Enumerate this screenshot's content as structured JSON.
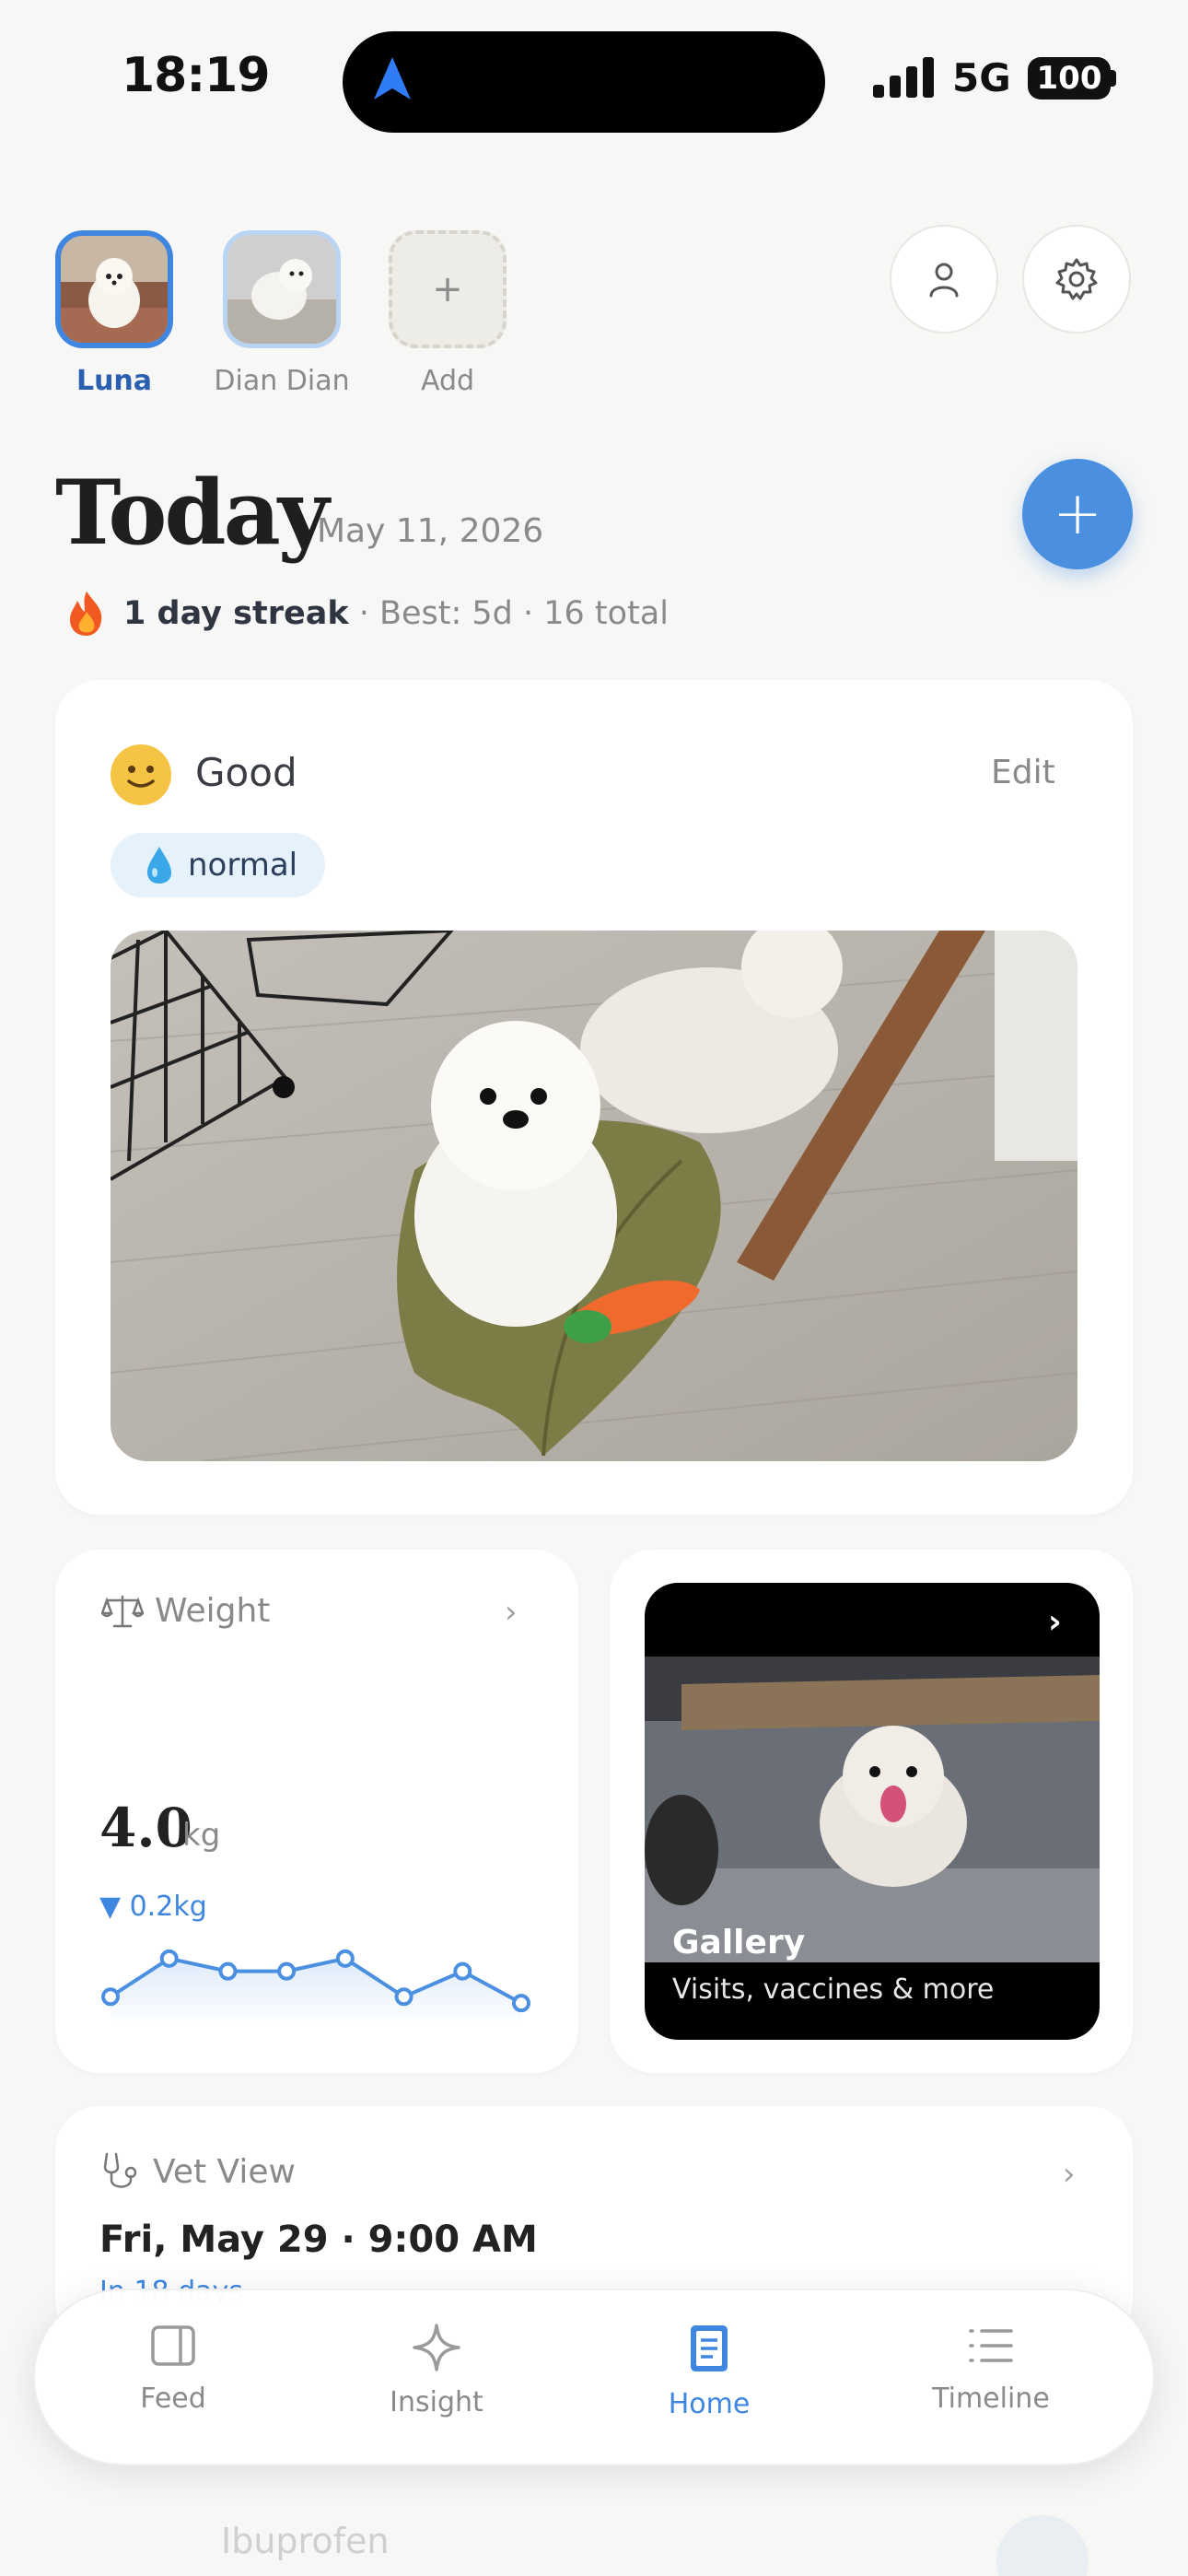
{
  "status_bar": {
    "time": "18:19",
    "network": "5G",
    "battery": "100"
  },
  "pets": [
    {
      "name": "Luna",
      "selected": true
    },
    {
      "name": "Dian Dian",
      "selected": false
    },
    {
      "name": "Add",
      "add_button": true,
      "icon": "plus-icon"
    }
  ],
  "header_actions": {
    "profile_icon": "person-icon",
    "settings_icon": "gear-icon"
  },
  "header": {
    "title": "Today",
    "date": "May 11, 2026",
    "add_icon": "plus-icon"
  },
  "streak": {
    "icon": "fire-icon",
    "label": "1 day streak",
    "details": "· Best: 5d · 16 total"
  },
  "mood": {
    "emoji": "slightly-smiling-face",
    "label": "Good",
    "edit_label": "Edit",
    "chip_icon": "droplet-icon",
    "chip_label": "normal"
  },
  "weight": {
    "title": "Weight",
    "value": "4.0",
    "unit": "kg",
    "delta": "0.2kg",
    "delta_direction": "down"
  },
  "chart_data": {
    "type": "line",
    "x": [
      1,
      2,
      3,
      4,
      5,
      6,
      7,
      8
    ],
    "values": [
      4.1,
      4.7,
      4.5,
      4.5,
      4.7,
      4.1,
      4.5,
      4.0
    ],
    "ylim": [
      3.8,
      4.9
    ],
    "grid": false,
    "note_color": "#4a8fe0"
  },
  "gallery": {
    "title": "Gallery",
    "subtitle": "Visits, vaccines & more"
  },
  "vet": {
    "title": "Vet View",
    "datetime": "Fri, May 29 · 9:00 AM",
    "in_days": "In 18 days"
  },
  "behind_content": {
    "text": "Ibuprofen"
  },
  "tabs": [
    {
      "label": "Feed",
      "icon": "feed-icon",
      "active": false
    },
    {
      "label": "Insight",
      "icon": "sparkle-icon",
      "active": false
    },
    {
      "label": "Home",
      "icon": "book-icon",
      "active": true
    },
    {
      "label": "Timeline",
      "icon": "list-icon",
      "active": false
    }
  ],
  "colors": {
    "accent": "#3e86e0",
    "background": "#f7f7f5",
    "card": "#ffffff"
  }
}
